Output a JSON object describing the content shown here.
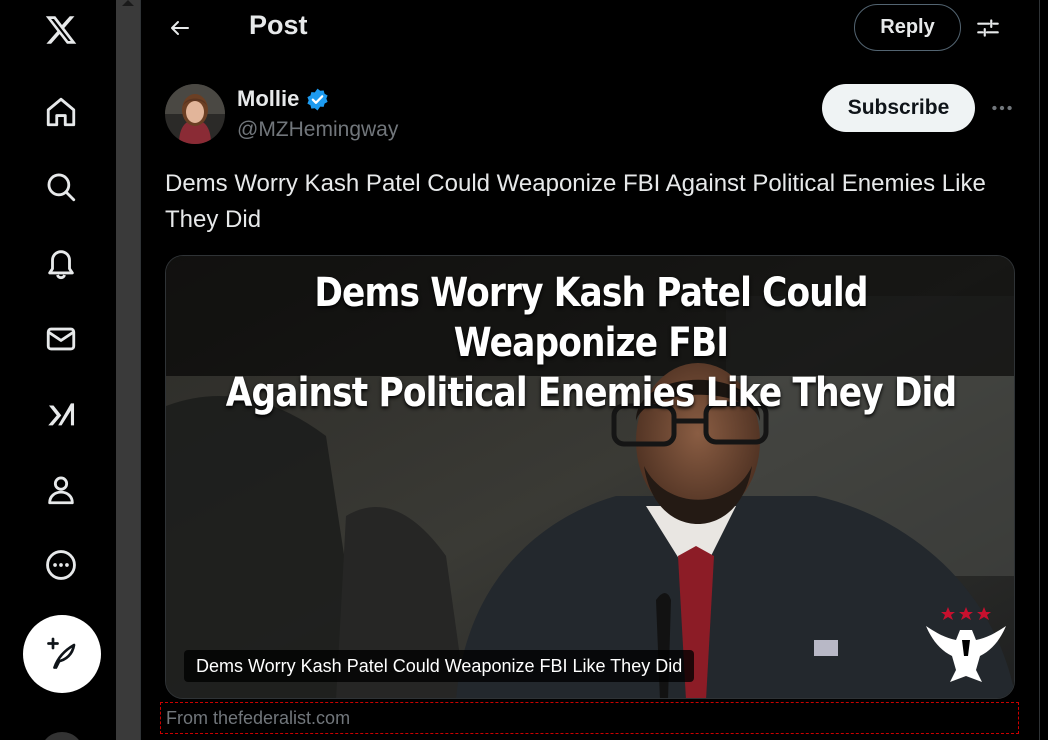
{
  "nav": {
    "items": [
      {
        "name": "x-logo-icon"
      },
      {
        "name": "home-icon"
      },
      {
        "name": "search-icon"
      },
      {
        "name": "bell-icon"
      },
      {
        "name": "mail-icon"
      },
      {
        "name": "grok-icon"
      },
      {
        "name": "profile-icon"
      },
      {
        "name": "more-circle-icon"
      }
    ],
    "compose_icon": "compose-feather-icon"
  },
  "header": {
    "title": "Post",
    "reply_label": "Reply"
  },
  "author": {
    "name": "Mollie",
    "handle": "@MZHemingway",
    "verified": true,
    "subscribe_label": "Subscribe"
  },
  "post": {
    "text": "Dems Worry Kash Patel Could Weaponize FBI Against Political Enemies Like They Did",
    "media": {
      "headline_line1": "Dems Worry Kash Patel Could Weaponize FBI",
      "headline_line2": "Against Political Enemies Like They Did",
      "caption": "Dems Worry Kash Patel Could Weaponize FBI Like They Did"
    },
    "source": "From thefederalist.com"
  },
  "colors": {
    "background": "#000000",
    "text": "#e7e9ea",
    "muted": "#71767b",
    "verified": "#1d9bf0",
    "border": "#2f3336"
  }
}
